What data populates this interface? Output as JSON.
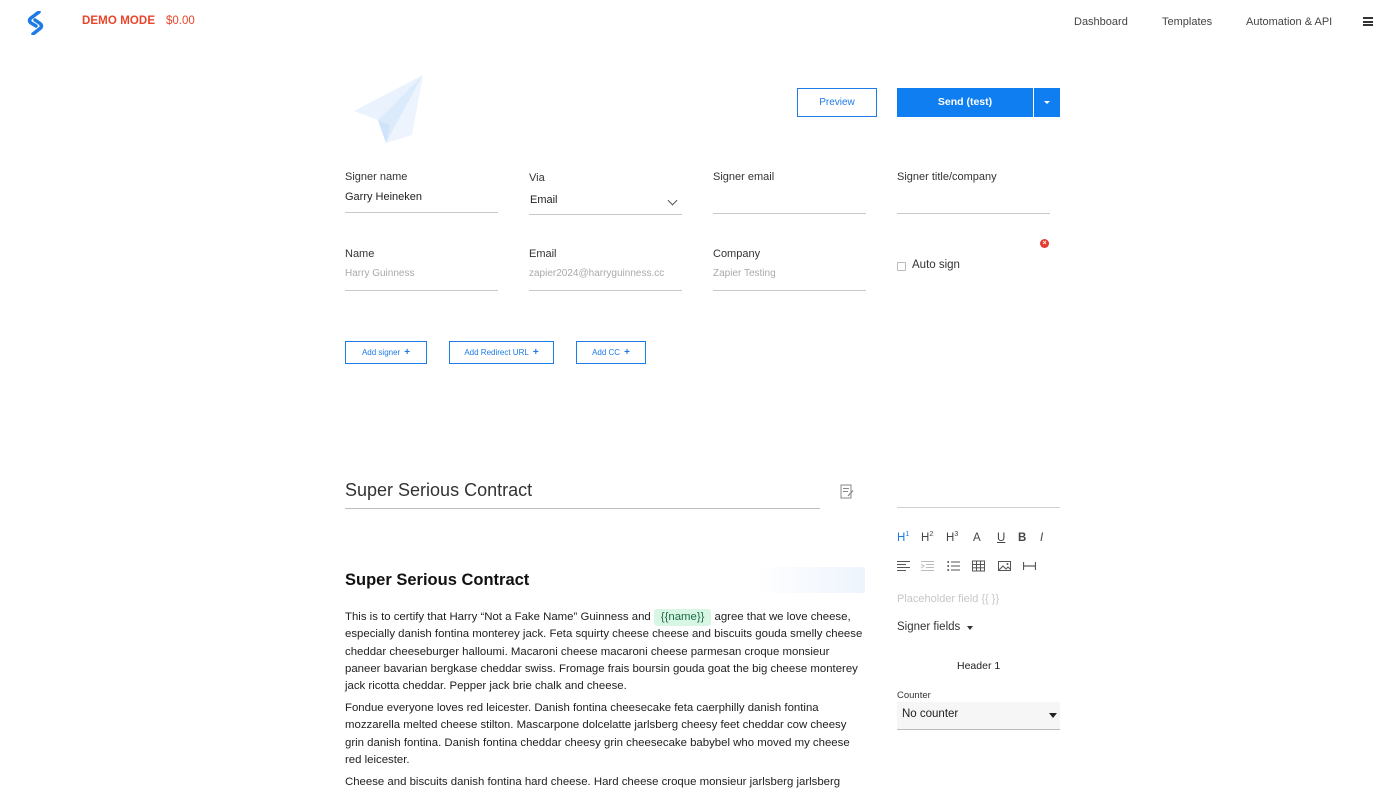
{
  "nav": {
    "demo_mode": "DEMO MODE",
    "balance": "$0.00",
    "links": [
      "Dashboard",
      "Templates",
      "Automation & API"
    ],
    "logo_icon": "signwell-logo-icon",
    "menu_icon": "hamburger-menu-icon"
  },
  "header": {
    "illustration_icon": "paper-plane-icon",
    "preview_label": "Preview",
    "send_label": "Send (test)"
  },
  "signer": {
    "name_label": "Signer name",
    "name_value": "Garry Heineken",
    "via_label": "Via",
    "via_value": "Email",
    "email_label": "Signer email",
    "email_value": "",
    "title_label": "Signer title/company",
    "title_value": ""
  },
  "recipient": {
    "name_label": "Name",
    "name_placeholder": "Harry Guinness",
    "email_label": "Email",
    "email_placeholder": "zapier2024@harryguinness.cc",
    "company_label": "Company",
    "company_placeholder": "Zapier Testing",
    "auto_sign_label": "Auto sign",
    "auto_sign_checked": false
  },
  "actions": {
    "add_signer": "Add signer",
    "add_redirect": "Add Redirect URL",
    "add_cc": "Add CC"
  },
  "document": {
    "title": "Super Serious Contract",
    "heading": "Super Serious Contract",
    "p1_before": "This is to certify that Harry “Not a Fake Name” Guinness and",
    "p1_tag": "{{name}}",
    "p1_after": "agree that we love cheese, especially danish fontina monterey jack. Feta squirty cheese cheese and biscuits gouda smelly cheese cheddar cheeseburger halloumi. Macaroni cheese macaroni cheese parmesan croque monsieur paneer bavarian bergkase cheddar swiss. Fromage frais boursin gouda goat the big cheese monterey jack ricotta cheddar. Pepper jack brie chalk and cheese.",
    "p2": "Fondue everyone loves red leicester. Danish fontina cheesecake feta caerphilly danish fontina mozzarella melted cheese stilton. Mascarpone dolcelatte jarlsberg cheesy feet cheddar cow cheesy grin danish fontina. Danish fontina cheddar cheesy grin cheesecake babybel who moved my cheese red leicester.",
    "p3": "Cheese and biscuits danish fontina hard cheese. Hard cheese croque monsieur jarlsberg jarlsberg"
  },
  "editor": {
    "h1": "H",
    "h2": "H",
    "h3": "H",
    "h1_sup": "1",
    "h2_sup": "2",
    "h3_sup": "3",
    "font_color": "A",
    "underline": "U",
    "bold": "B",
    "italic": "I",
    "placeholder_field": "Placeholder field  {{ }}",
    "signer_fields": "Signer fields",
    "header_label": "Header 1",
    "counter_label": "Counter",
    "counter_value": "No counter"
  },
  "colors": {
    "accent": "#0f7ef0",
    "demo": "#e8452c",
    "tag_bg": "#d7f6e4"
  }
}
